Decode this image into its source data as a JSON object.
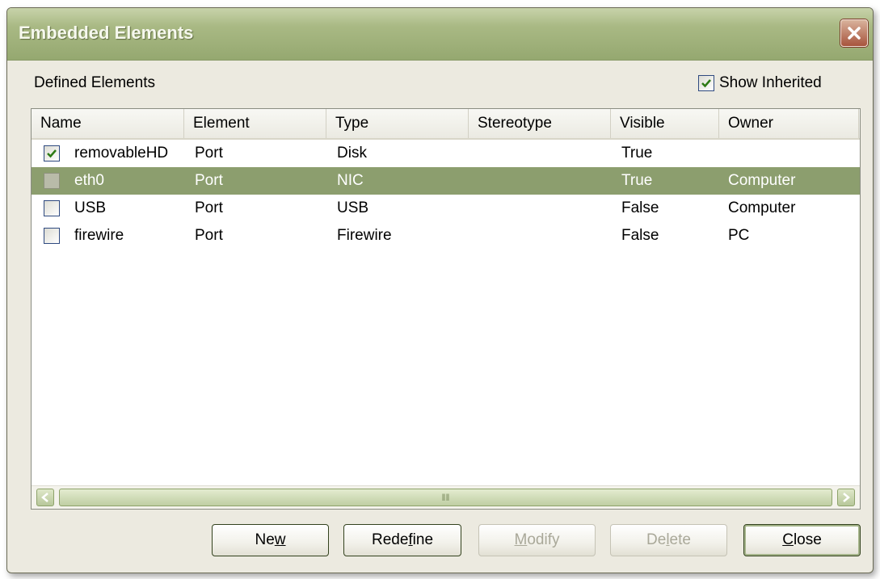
{
  "window": {
    "title": "Embedded Elements"
  },
  "defined_label": "Defined Elements",
  "show_inherited": {
    "label": "Show Inherited",
    "checked": true
  },
  "columns": [
    "Name",
    "Element",
    "Type",
    "Stereotype",
    "Visible",
    "Owner"
  ],
  "rows": [
    {
      "checked": true,
      "name": "removableHD",
      "element": "Port",
      "type": "Disk",
      "stereotype": "",
      "visible": "True",
      "owner": ""
    },
    {
      "checked": false,
      "name": "eth0",
      "element": "Port",
      "type": "NIC",
      "stereotype": "",
      "visible": "True",
      "owner": "Computer",
      "selected": true
    },
    {
      "checked": false,
      "name": "USB",
      "element": "Port",
      "type": "USB",
      "stereotype": "",
      "visible": "False",
      "owner": "Computer"
    },
    {
      "checked": false,
      "name": "firewire",
      "element": "Port",
      "type": "Firewire",
      "stereotype": "",
      "visible": "False",
      "owner": "PC"
    }
  ],
  "buttons": [
    {
      "label": "New",
      "accel": "w",
      "enabled": true
    },
    {
      "label": "Redefine",
      "accel": "f",
      "enabled": true
    },
    {
      "label": "Modify",
      "accel": "M",
      "enabled": false
    },
    {
      "label": "Delete",
      "accel": "l",
      "enabled": false
    },
    {
      "label": "Close",
      "accel": "C",
      "enabled": true
    }
  ],
  "icons": {
    "close": "close-x-icon",
    "check": "check-icon",
    "scroll_left": "arrow-left-icon",
    "scroll_right": "arrow-right-icon",
    "grip": "grip-icon"
  },
  "colors": {
    "title_bar": "#a9b984",
    "selection": "#8c9e6e",
    "dialog_bg": "#ECEAE0"
  }
}
